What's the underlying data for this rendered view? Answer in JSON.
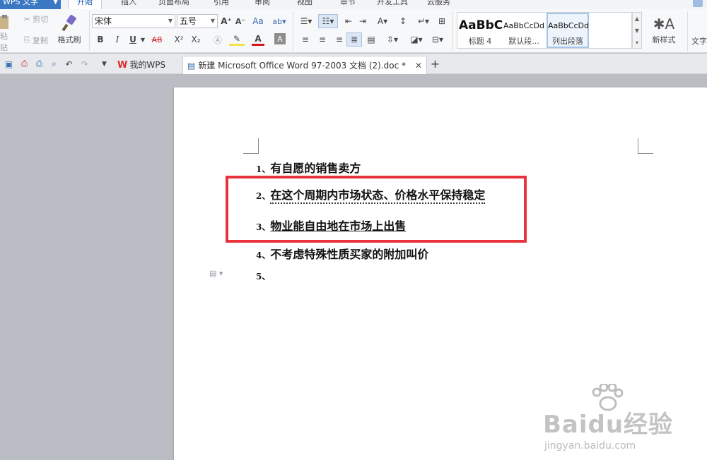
{
  "app": {
    "name": "WPS 文字",
    "menu_tabs": [
      "开始",
      "插入",
      "页面布局",
      "引用",
      "审阅",
      "视图",
      "章节",
      "开发工具",
      "云服务"
    ]
  },
  "ribbon": {
    "paste_label": "粘贴",
    "cut_label": "剪切",
    "copy_label": "复制",
    "format_painter_label": "格式刷",
    "font_name": "宋体",
    "font_size": "五号",
    "grow_font": "A⁺",
    "shrink_font": "A⁻",
    "bold": "B",
    "italic": "I",
    "underline": "U",
    "strikethrough": "AB",
    "superscript": "X²",
    "subscript": "X₂",
    "font_color": "A",
    "styles": [
      {
        "sample": "AaBbC",
        "name": "标题 4"
      },
      {
        "sample": "AaBbCcDd",
        "name": "默认段..."
      },
      {
        "sample": "AaBbCcDd",
        "name": "列出段落"
      }
    ],
    "new_style_label": "新样式",
    "text_tools_label": "文字"
  },
  "tabs": [
    {
      "label": "我的WPS"
    },
    {
      "label": "新建 Microsoft Office Word 97-2003 文档 (2).doc *"
    }
  ],
  "document": {
    "paragraphs": [
      {
        "number": "1、",
        "text": "有自愿的销售卖方"
      },
      {
        "number": "2、",
        "text": "在这个周期内市场状态、价格水平保持稳定"
      },
      {
        "number": "3、",
        "text": "物业能自由地在市场上出售"
      },
      {
        "number": "4、",
        "text": "不考虑特殊性质买家的附加叫价"
      },
      {
        "number": "5、",
        "text": ""
      }
    ]
  },
  "watermark": {
    "logo": "Baidu经验",
    "url": "jingyan.baidu.com"
  },
  "colors": {
    "app_button": "#3b78c4",
    "highlight_box": "#e8333d",
    "workspace": "#babdc3"
  }
}
